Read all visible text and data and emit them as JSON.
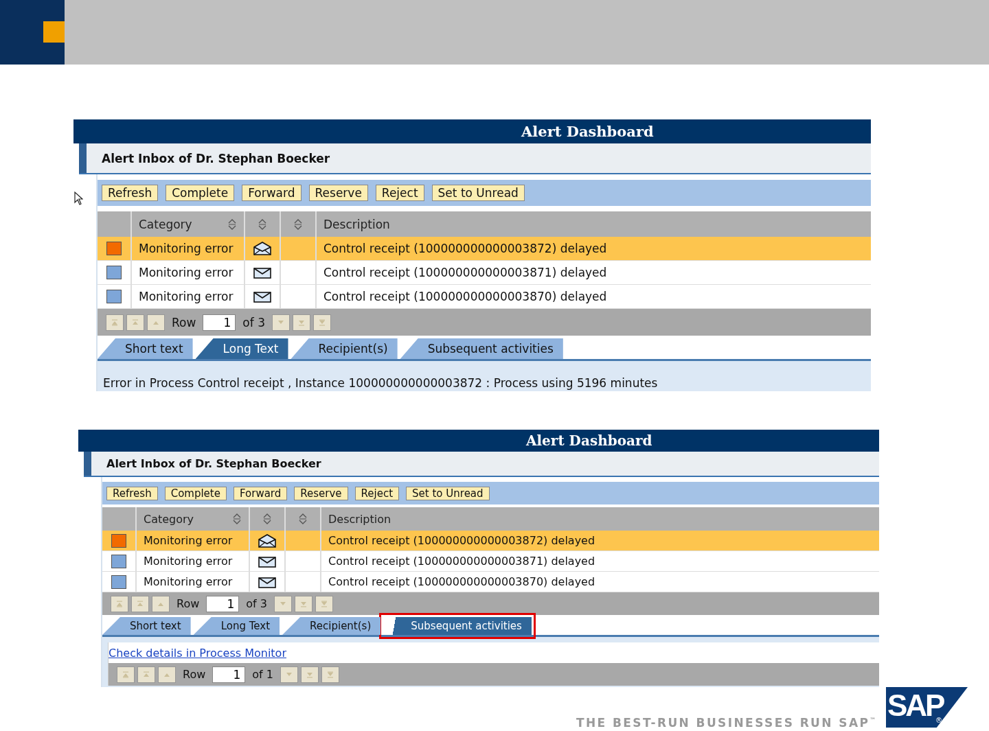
{
  "panels": [
    {
      "title": "Alert Dashboard",
      "inbox_title": "Alert Inbox of Dr. Stephan Boecker",
      "buttons": [
        "Refresh",
        "Complete",
        "Forward",
        "Reserve",
        "Reject",
        "Set to Unread"
      ],
      "columns": [
        {
          "sortable": false
        },
        {
          "label": "Category",
          "sortable": true
        },
        {
          "sortable": true
        },
        {
          "sortable": true
        },
        {
          "label": "Description",
          "sortable": false
        }
      ],
      "rows": [
        {
          "selected": true,
          "color": "#f26a00",
          "opened": true,
          "category": "Monitoring error",
          "description": "Control receipt (100000000000003872) delayed"
        },
        {
          "selected": false,
          "color": "#7ea6d8",
          "opened": false,
          "category": "Monitoring error",
          "description": "Control receipt (100000000000003871) delayed"
        },
        {
          "selected": false,
          "color": "#7ea6d8",
          "opened": false,
          "category": "Monitoring error",
          "description": "Control receipt (100000000000003870) delayed"
        }
      ],
      "pager": {
        "label": "Row",
        "value": "1",
        "total": "of 3"
      },
      "tabs": [
        {
          "label": "Short text",
          "selected": false,
          "highlighted": false
        },
        {
          "label": "Long Text",
          "selected": true,
          "highlighted": false
        },
        {
          "label": "Recipient(s)",
          "selected": false,
          "highlighted": false
        },
        {
          "label": "Subsequent activities",
          "selected": false,
          "highlighted": false
        }
      ],
      "detail": {
        "kind": "text",
        "text": "Error in Process Control receipt , Instance 100000000000003872 : Process using 5196 minutes"
      },
      "cursor": true
    },
    {
      "title": "Alert Dashboard",
      "inbox_title": "Alert Inbox of Dr. Stephan Boecker",
      "buttons": [
        "Refresh",
        "Complete",
        "Forward",
        "Reserve",
        "Reject",
        "Set to Unread"
      ],
      "columns": [
        {
          "sortable": false
        },
        {
          "label": "Category",
          "sortable": true
        },
        {
          "sortable": true
        },
        {
          "sortable": true
        },
        {
          "label": "Description",
          "sortable": false
        }
      ],
      "rows": [
        {
          "selected": true,
          "color": "#f26a00",
          "opened": true,
          "category": "Monitoring error",
          "description": "Control receipt (100000000000003872) delayed"
        },
        {
          "selected": false,
          "color": "#7ea6d8",
          "opened": false,
          "category": "Monitoring error",
          "description": "Control receipt (100000000000003871) delayed"
        },
        {
          "selected": false,
          "color": "#7ea6d8",
          "opened": false,
          "category": "Monitoring error",
          "description": "Control receipt (100000000000003870) delayed"
        }
      ],
      "pager": {
        "label": "Row",
        "value": "1",
        "total": "of 3"
      },
      "tabs": [
        {
          "label": "Short text",
          "selected": false,
          "highlighted": false
        },
        {
          "label": "Long Text",
          "selected": false,
          "highlighted": false
        },
        {
          "label": "Recipient(s)",
          "selected": false,
          "highlighted": false
        },
        {
          "label": "Subsequent activities",
          "selected": true,
          "highlighted": true
        }
      ],
      "detail": {
        "kind": "link",
        "text": "Check details in Process Monitor",
        "pager": {
          "label": "Row",
          "value": "1",
          "total": "of 1"
        }
      }
    }
  ],
  "footer": {
    "tagline": "THE BEST-RUN BUSINESSES RUN SAP",
    "trademark": "™",
    "logo": "SAP",
    "registered": "®"
  }
}
